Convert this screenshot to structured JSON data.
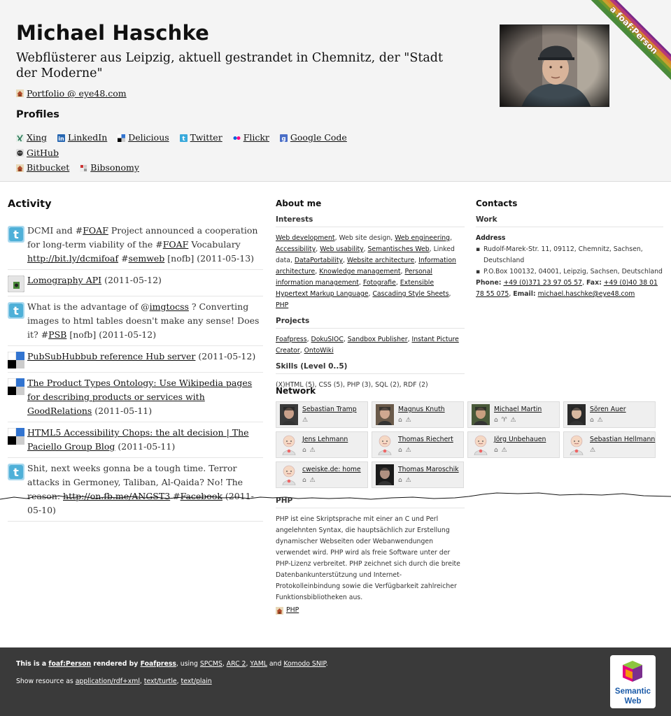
{
  "header": {
    "name": "Michael Haschke",
    "tagline": "Webflüsterer aus Leipzig, aktuell gestrandet in Chemnitz, der \"Stadt der Moderne\"",
    "portfolio": "Portfolio @ eye48.com",
    "profiles_title": "Profiles",
    "profiles": [
      {
        "label": "Xing",
        "icon": "xing-icon",
        "color": "#2d7a5a"
      },
      {
        "label": "LinkedIn",
        "icon": "linkedin-icon",
        "color": "#2867b2"
      },
      {
        "label": "Delicious",
        "icon": "delicious-icon",
        "color": "#3274d0"
      },
      {
        "label": "Twitter",
        "icon": "twitter-icon",
        "color": "#39a9db"
      },
      {
        "label": "Flickr",
        "icon": "flickr-icon",
        "color": "#ff0084"
      },
      {
        "label": "Google Code",
        "icon": "google-code-icon",
        "color": "#4a6ec7"
      },
      {
        "label": "GitHub",
        "icon": "github-icon",
        "color": "#333333"
      },
      {
        "label": "Bitbucket",
        "icon": "bitbucket-icon",
        "color": "#7a5a2a"
      },
      {
        "label": "Bibsonomy",
        "icon": "bibsonomy-icon",
        "color": "#888888"
      }
    ],
    "ribbon": "a foaf:Person"
  },
  "activity": {
    "title": "Activity",
    "items": [
      {
        "icon": "twitter",
        "text": "DCMI and #FOAF Project announced a cooperation for long-term viability of the #FOAF Vocabulary http://bit.ly/dcmifoaf #semweb [nofb] (2011-05-13)"
      },
      {
        "icon": "lomography",
        "text": "Lomography API (2011-05-12)"
      },
      {
        "icon": "twitter",
        "text": "What is the advantage of @imgtocss ? Converting images to html tables doesn't make any sense! Does it? #PSB [nofb] (2011-05-12)"
      },
      {
        "icon": "delicious",
        "text": "PubSubHubbub reference Hub server (2011-05-12)"
      },
      {
        "icon": "delicious",
        "text": "The Product Types Ontology: Use Wikipedia pages for describing products or services with GoodRelations (2011-05-11)"
      },
      {
        "icon": "delicious",
        "text": "HTML5 Accessibility Chops: the alt decision | The Paciello Group Blog (2011-05-11)"
      },
      {
        "icon": "twitter",
        "text": "Shit, next weeks gonna be a tough time. Terror attacks in Germoney, Taliban, Al-Qaida? No! The reason: http://on.fb.me/ANGST3 #Facebook (2011-05-10)"
      }
    ]
  },
  "about": {
    "title": "About me",
    "interests_title": "Interests",
    "interests": [
      {
        "t": "Web development",
        "link": true
      },
      {
        "t": "Web site design",
        "link": false
      },
      {
        "t": "Web engineering",
        "link": true
      },
      {
        "t": "Accessibility",
        "link": true
      },
      {
        "t": "Web usability",
        "link": true
      },
      {
        "t": "Semantisches Web",
        "link": true
      },
      {
        "t": "Linked data",
        "link": false
      },
      {
        "t": "DataPortability",
        "link": true
      },
      {
        "t": "Website architecture",
        "link": true
      },
      {
        "t": "Information architecture",
        "link": true
      },
      {
        "t": "Knowledge management",
        "link": true
      },
      {
        "t": "Personal information management",
        "link": true
      },
      {
        "t": "Fotografie",
        "link": true
      },
      {
        "t": "Extensible Hypertext Markup Language",
        "link": true
      },
      {
        "t": "Cascading Style Sheets",
        "link": true
      },
      {
        "t": "PHP",
        "link": true
      }
    ],
    "projects_title": "Projects",
    "projects": [
      "Foafpress",
      "DokuSIOC",
      "Sandbox Publisher",
      "Instant Picture Creator",
      "OntoWiki"
    ],
    "skills_title": "Skills (Level 0..5)",
    "skills": "(X)HTML (5), CSS (5), PHP (3), SQL (2), RDF (2)"
  },
  "network": {
    "title": "Network",
    "people": [
      {
        "name": "Sebastian Tramp",
        "icons": "⚠",
        "photo": true
      },
      {
        "name": "Magnus Knuth",
        "icons": "⌂ ⚠",
        "photo": true
      },
      {
        "name": "Michael Martin",
        "icons": "⌂ ♈ ⚠",
        "photo": true
      },
      {
        "name": "Sören Auer",
        "icons": "⌂ ⚠",
        "photo": true
      },
      {
        "name": "Jens Lehmann",
        "icons": "⌂ ⚠",
        "photo": false
      },
      {
        "name": "Thomas Riechert",
        "icons": "⌂ ⚠",
        "photo": false
      },
      {
        "name": "Jörg Unbehauen",
        "icons": "⌂ ⚠",
        "photo": false
      },
      {
        "name": "Sebastian Hellmann",
        "icons": "⚠",
        "photo": false
      },
      {
        "name": "cweiske.de: home",
        "icons": "⌂ ⚠",
        "photo": false
      },
      {
        "name": "Thomas Maroschik",
        "icons": "⌂ ⚠",
        "photo": true
      }
    ]
  },
  "php": {
    "title": "PHP",
    "text": "PHP ist eine Skriptsprache mit einer an C und Perl angelehnten Syntax, die hauptsächlich zur Erstellung dynamischer Webseiten oder Webanwendungen verwendet wird. PHP wird als freie Software unter der PHP-Lizenz verbreitet. PHP zeichnet sich durch die breite Datenbankunterstützung und Internet-Protokolleinbindung sowie die Verfügbarkeit zahlreicher Funktionsbibliotheken aus.",
    "link": "PHP"
  },
  "contacts": {
    "title": "Contacts",
    "work_title": "Work",
    "address_title": "Address",
    "addresses": [
      "Rudolf-Marek-Str. 11, 09112, Chemnitz, Sachsen, Deutschland",
      "P.O.Box 100132, 04001, Leipzig, Sachsen, Deutschland"
    ],
    "phone_label": "Phone:",
    "phone": "+49 (0)371 23 97 05 57",
    "fax_label": "Fax:",
    "fax": "+49 (0)40 38 01 78 55 075",
    "email_label": "Email:",
    "email": "michael.haschke@eye48.com"
  },
  "footer": {
    "line1_a": "This is a",
    "line1_b": "foaf:Person",
    "line1_c": "rendered by",
    "line1_d": "Foafpress",
    "line1_e": ", using",
    "line1_links": [
      "SPCMS",
      "ARC 2",
      "YAML",
      "Komodo SNIP"
    ],
    "line2_label": "Show resource as",
    "formats": [
      "application/rdf+xml",
      "text/turtle",
      "text/plain"
    ],
    "badge": "Semantic Web"
  },
  "colors": {
    "twitter": "#4fb0d8",
    "delicious": "#3274d0",
    "footer_bg": "#3a3a3a",
    "header_bg": "#f4f4f4"
  }
}
